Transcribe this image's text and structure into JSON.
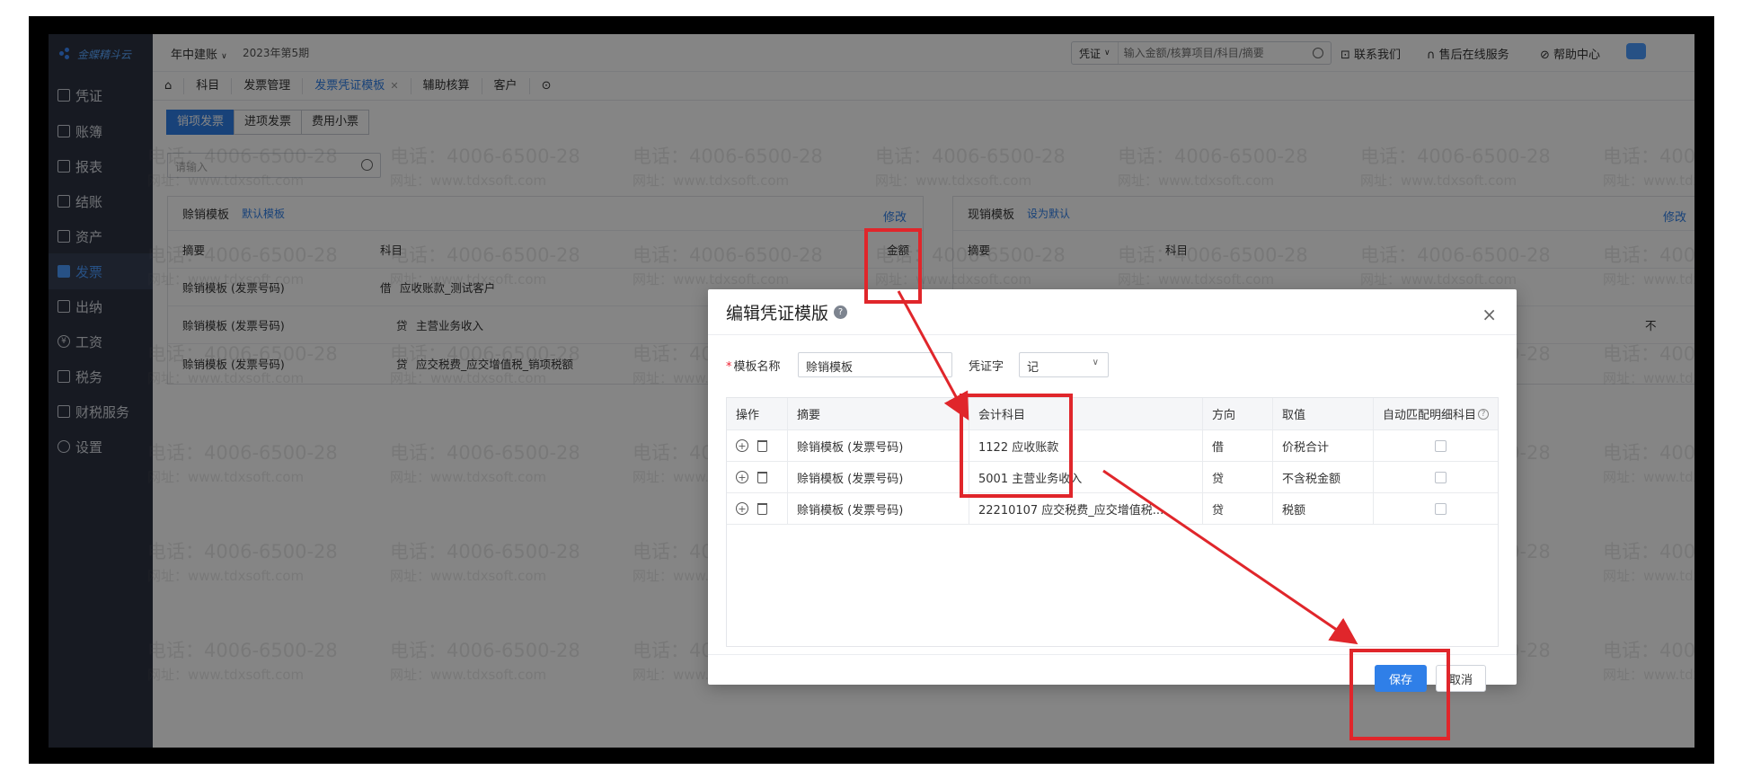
{
  "brand": {
    "logo_text": "金蝶精斗云"
  },
  "header": {
    "company": "年中建账",
    "period": "2023年第5期",
    "search_type": "凭证",
    "search_placeholder": "输入金额/核算项目/科目/摘要",
    "contact": "联系我们",
    "service": "售后在线服务",
    "help": "帮助中心"
  },
  "sidebar": {
    "items": [
      {
        "label": "凭证",
        "icon": "doc-icon",
        "active": false
      },
      {
        "label": "账簿",
        "icon": "book-icon",
        "active": false
      },
      {
        "label": "报表",
        "icon": "report-icon",
        "active": false
      },
      {
        "label": "结账",
        "icon": "close-books-icon",
        "active": false
      },
      {
        "label": "资产",
        "icon": "asset-icon",
        "active": false
      },
      {
        "label": "发票",
        "icon": "invoice-icon",
        "active": true
      },
      {
        "label": "出纳",
        "icon": "cashier-icon",
        "active": false
      },
      {
        "label": "工资",
        "icon": "yen-icon",
        "active": false
      },
      {
        "label": "税务",
        "icon": "tax-icon",
        "active": false
      },
      {
        "label": "财税服务",
        "icon": "service-icon",
        "active": false
      },
      {
        "label": "设置",
        "icon": "settings-icon",
        "active": false
      }
    ]
  },
  "tabs": [
    {
      "label": "科目"
    },
    {
      "label": "发票管理"
    },
    {
      "label": "发票凭证模板",
      "active": true
    },
    {
      "label": "辅助核算"
    },
    {
      "label": "客户"
    }
  ],
  "invoice_types": [
    "销项发票",
    "进项发票",
    "费用小票"
  ],
  "list_search_placeholder": "请输入",
  "credit_template": {
    "title": "赊销模板",
    "badge": "默认模板",
    "edit": "修改",
    "col_summary": "摘要",
    "col_account": "科目",
    "col_amount": "金额",
    "rows": [
      {
        "summary": "赊销模板 (发票号码)",
        "dir": "借",
        "account": "应收账款_测试客户"
      },
      {
        "summary": "赊销模板 (发票号码)",
        "dir": "贷",
        "account": "主营业务收入"
      },
      {
        "summary": "赊销模板 (发票号码)",
        "dir": "贷",
        "account": "应交税费_应交增值税_销项税额"
      }
    ]
  },
  "cash_template": {
    "title": "现销模板",
    "badge": "设为默认",
    "edit": "修改",
    "col_summary": "摘要",
    "col_account": "科目",
    "trailing": "不"
  },
  "modal": {
    "title": "编辑凭证模版",
    "name_label": "模板名称",
    "name_value": "赊销模板",
    "voucher_label": "凭证字",
    "voucher_value": "记",
    "columns": [
      "操作",
      "摘要",
      "会计科目",
      "方向",
      "取值",
      "自动匹配明细科目"
    ],
    "rows": [
      {
        "summary": "赊销模板 (发票号码)",
        "account": "1122 应收账款",
        "dir": "借",
        "value": "价税合计"
      },
      {
        "summary": "赊销模板 (发票号码)",
        "account": "5001 主营业务收入",
        "dir": "贷",
        "value": "不含税金额"
      },
      {
        "summary": "赊销模板 (发票号码)",
        "account": "22210107 应交税费_应交增值税...",
        "dir": "贷",
        "value": "税额"
      }
    ],
    "save": "保存",
    "cancel": "取消"
  },
  "watermark": {
    "phone": "电话：4006-6500-28",
    "site": "网址：www.tdxsoft.com"
  },
  "colors": {
    "accent": "#2f7fe8",
    "annotation": "#e0262b",
    "sidebar": "#2d3341"
  }
}
